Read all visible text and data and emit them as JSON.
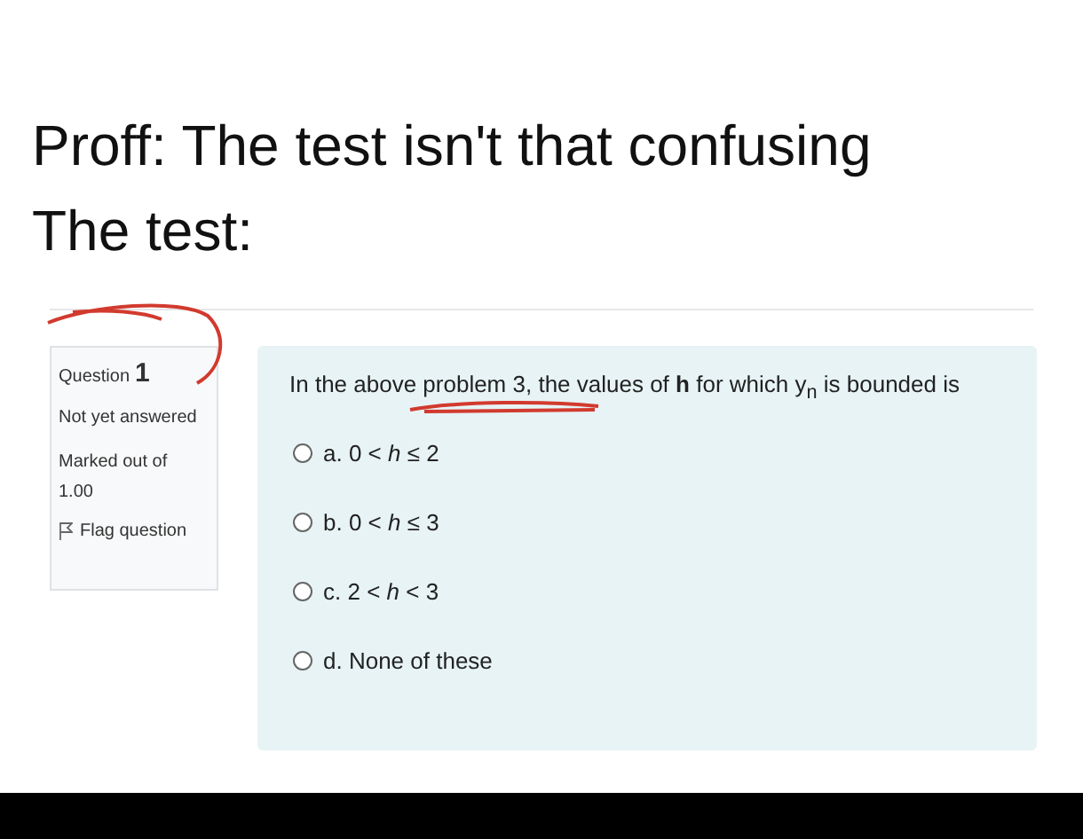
{
  "caption": [
    "Proff: The test isn't that confusing",
    "The test:"
  ],
  "question": {
    "label": "Question",
    "number": "1",
    "status": "Not yet answered",
    "marks": "Marked out of 1.00",
    "flag": "Flag question",
    "text": "In the above problem 3, the values of **h** for which y$_{n}$ is bounded is",
    "options": [
      {
        "text": "a. 0 < *h* ≤ 2",
        "selected": false
      },
      {
        "text": "b. 0 < *h* ≤ 3",
        "selected": false
      },
      {
        "text": "c. 2 < *h* < 3",
        "selected": false
      },
      {
        "text": "d. None of these",
        "selected": false
      }
    ]
  }
}
